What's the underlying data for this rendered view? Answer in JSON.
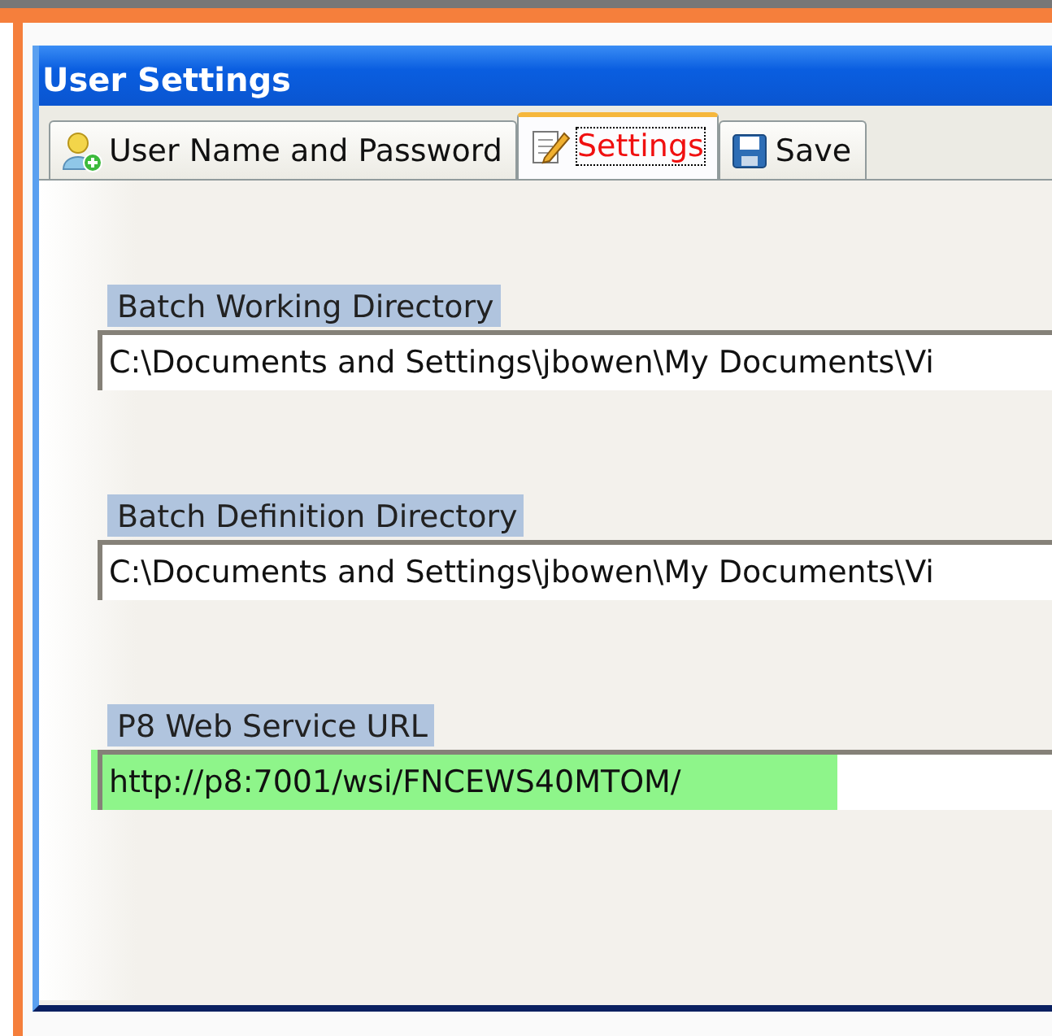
{
  "window": {
    "title": "User Settings"
  },
  "tabs": [
    {
      "label": "User Name and Password",
      "selected": false
    },
    {
      "label": "Settings",
      "selected": true
    },
    {
      "label": "Save",
      "selected": false
    }
  ],
  "fields": [
    {
      "label": "Batch Working Directory",
      "value": "C:\\Documents and Settings\\jbowen\\My Documents\\Vi",
      "highlighted": false
    },
    {
      "label": "Batch Definition Directory",
      "value": "C:\\Documents and Settings\\jbowen\\My Documents\\Vi",
      "highlighted": false
    },
    {
      "label": "P8 Web Service URL",
      "value": "http://p8:7001/wsi/FNCEWS40MTOM/",
      "highlighted": true
    }
  ]
}
